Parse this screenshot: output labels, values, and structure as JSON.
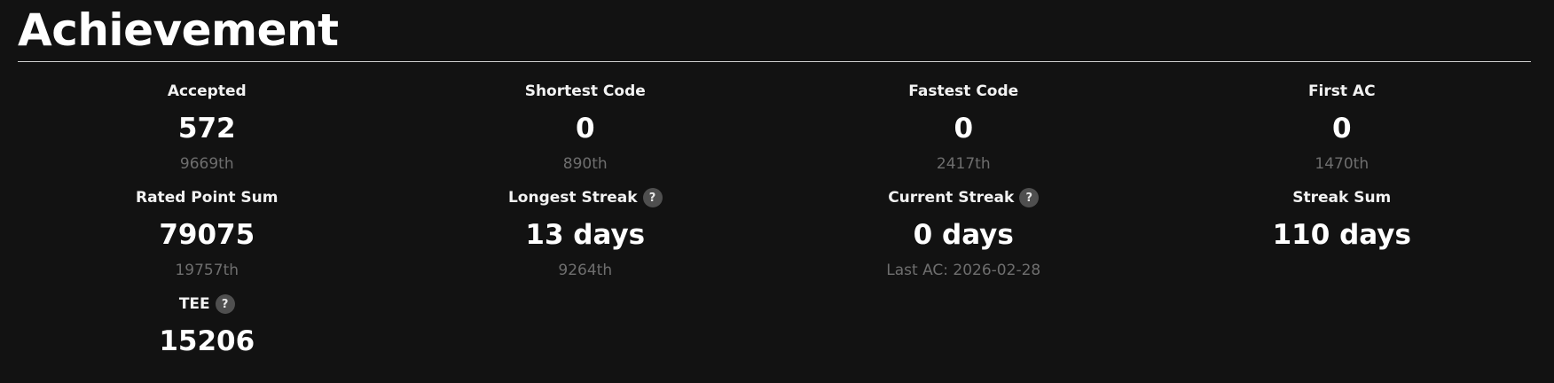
{
  "header": {
    "title": "Achievement"
  },
  "stats": [
    {
      "label": "Accepted",
      "value": "572",
      "rank": "9669th"
    },
    {
      "label": "Shortest Code",
      "value": "0",
      "rank": "890th"
    },
    {
      "label": "Fastest Code",
      "value": "0",
      "rank": "2417th"
    },
    {
      "label": "First AC",
      "value": "0",
      "rank": "1470th"
    },
    {
      "label": "Rated Point Sum",
      "value": "79075",
      "rank": "19757th"
    },
    {
      "label": "Longest Streak",
      "value": "13 days",
      "rank": "9264th",
      "help": "?"
    },
    {
      "label": "Current Streak",
      "value": "0 days",
      "rank": "Last AC: 2026-02-28",
      "help": "?"
    },
    {
      "label": "Streak Sum",
      "value": "110 days",
      "rank": ""
    },
    {
      "label": "TEE",
      "value": "15206",
      "rank": "",
      "help": "?"
    }
  ],
  "colors": {
    "background": "#121212",
    "text": "#ffffff",
    "muted": "#6e6e6e",
    "help_badge": "#4f4f4f"
  }
}
